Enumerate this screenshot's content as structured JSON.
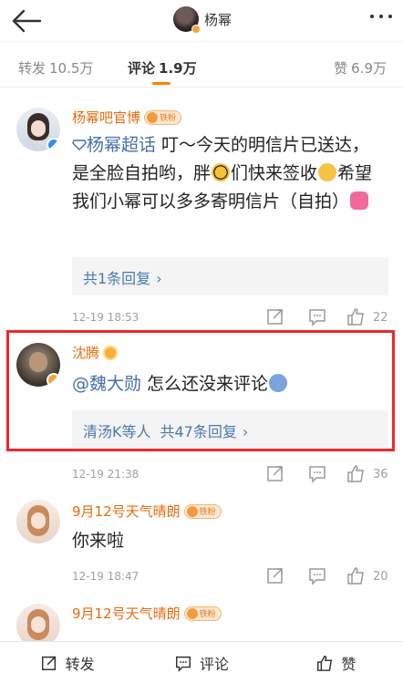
{
  "header": {
    "back_icon": "back-arrow-icon",
    "name": "杨幂",
    "more_icon": "more-dots-icon"
  },
  "tabs": {
    "repost_label": "转发",
    "repost_count": "10.5万",
    "comment_label": "评论",
    "comment_count": "1.9万",
    "like_label": "赞",
    "like_count": "6.9万"
  },
  "comments": [
    {
      "name": "杨幂吧官博",
      "badge": "铁粉",
      "topic": "杨幂超话",
      "text_1": " 叮～今天的明信片已送达，是全脸自拍哟，胖",
      "text_2": "们快来签收",
      "text_3": "希望我们小幂可以多多寄明信片（自拍）",
      "replies_label": "共1条回复",
      "time": "12-19 18:53",
      "likes": "22"
    },
    {
      "name": "沈腾",
      "mention": "@魏大勋",
      "text": " 怎么还没来评论",
      "replies_prefix": "清汤K等人",
      "replies_label": "共47条回复",
      "time": "12-19 21:38",
      "likes": "36"
    },
    {
      "name": "9月12号天气晴朗",
      "badge": "铁粉",
      "text": "你来啦",
      "time": "12-19 18:47",
      "likes": "20"
    },
    {
      "name": "9月12号天气晴朗",
      "badge": "铁粉"
    }
  ],
  "bottom": {
    "repost_label": "转发",
    "comment_label": "评论",
    "like_label": "赞"
  },
  "colors": {
    "accent": "#ff8200",
    "name_orange": "#e86b0c",
    "link_blue": "#466fa8",
    "highlight_red": "#f0272e"
  }
}
